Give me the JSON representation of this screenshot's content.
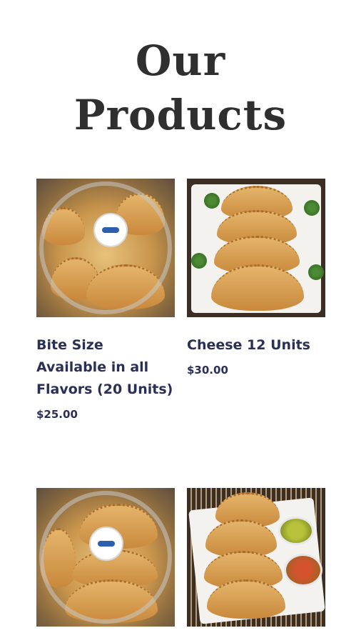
{
  "page": {
    "title_line1": "Our",
    "title_line2": "Products"
  },
  "products": [
    {
      "name": "Bite Size Available in all Flavors (20 Units)",
      "price": "$25.00",
      "image_icon": "empanada-tray-photo"
    },
    {
      "name": "Cheese 12 Units",
      "price": "$30.00",
      "image_icon": "cheese-empanadas-plate-photo"
    },
    {
      "name": "",
      "price": "",
      "image_icon": "empanada-tray-photo"
    },
    {
      "name": "",
      "price": "",
      "image_icon": "empanadas-with-salsa-photo"
    }
  ],
  "colors": {
    "title": "#2f2f2f",
    "product_text": "#2a2f55"
  }
}
